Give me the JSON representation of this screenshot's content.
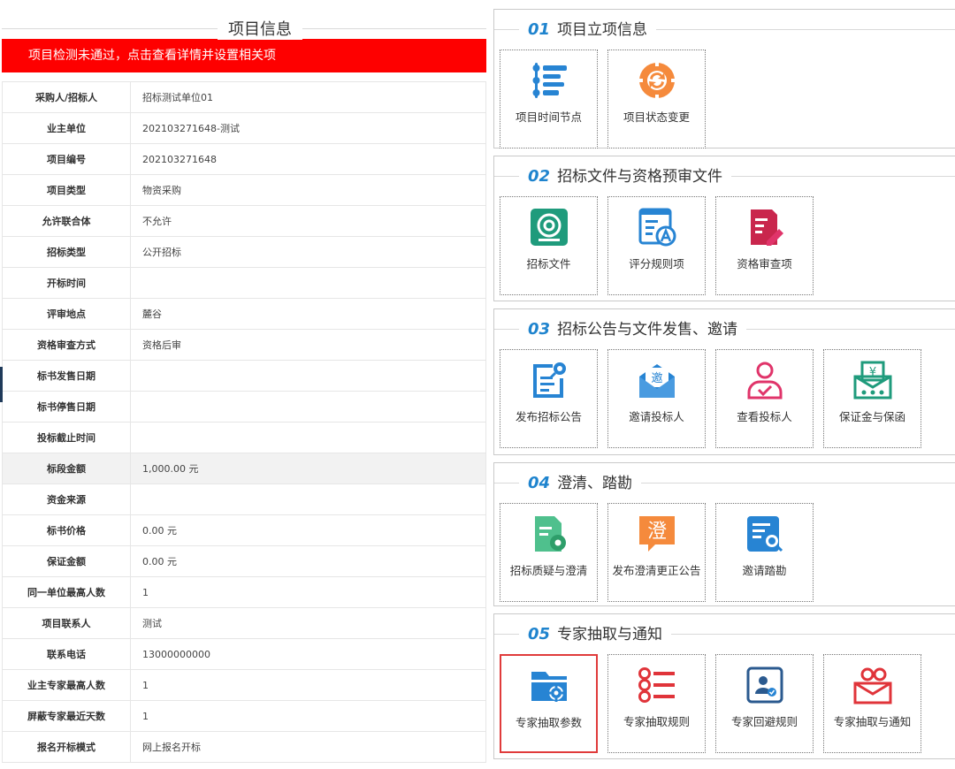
{
  "left": {
    "title": "项目信息",
    "alert": "项目检测未通过，点击查看详情并设置相关项",
    "rows": [
      {
        "label": "采购人/招标人",
        "value": "招标测试单位01"
      },
      {
        "label": "业主单位",
        "value": "202103271648-测试"
      },
      {
        "label": "项目编号",
        "value": "202103271648"
      },
      {
        "label": "项目类型",
        "value": "物资采购"
      },
      {
        "label": "允许联合体",
        "value": "不允许"
      },
      {
        "label": "招标类型",
        "value": "公开招标"
      },
      {
        "label": "开标时间",
        "value": ""
      },
      {
        "label": "评审地点",
        "value": "麓谷"
      },
      {
        "label": "资格审查方式",
        "value": "资格后审"
      },
      {
        "label": "标书发售日期",
        "value": ""
      },
      {
        "label": "标书停售日期",
        "value": ""
      },
      {
        "label": "投标截止时间",
        "value": ""
      },
      {
        "label": "标段金额",
        "value": "1,000.00 元"
      },
      {
        "label": "资金来源",
        "value": ""
      },
      {
        "label": "标书价格",
        "value": "0.00 元"
      },
      {
        "label": "保证金额",
        "value": "0.00 元"
      },
      {
        "label": "同一单位最高人数",
        "value": "1"
      },
      {
        "label": "项目联系人",
        "value": "测试"
      },
      {
        "label": "联系电话",
        "value": "13000000000"
      },
      {
        "label": "业主专家最高人数",
        "value": "1"
      },
      {
        "label": "屏蔽专家最近天数",
        "value": "1"
      },
      {
        "label": "报名开标模式",
        "value": "网上报名开标"
      }
    ]
  },
  "sections": [
    {
      "num": "01",
      "title": "项目立项信息",
      "tiles": [
        {
          "label": "项目时间节点",
          "icon": "timeline-icon"
        },
        {
          "label": "项目状态变更",
          "icon": "status-change-icon"
        }
      ]
    },
    {
      "num": "02",
      "title": "招标文件与资格预审文件",
      "tiles": [
        {
          "label": "招标文件",
          "icon": "tender-file-icon"
        },
        {
          "label": "评分规则项",
          "icon": "scoring-rule-icon"
        },
        {
          "label": "资格审查项",
          "icon": "qualification-review-icon"
        }
      ]
    },
    {
      "num": "03",
      "title": "招标公告与文件发售、邀请",
      "tiles": [
        {
          "label": "发布招标公告",
          "icon": "publish-notice-icon"
        },
        {
          "label": "邀请投标人",
          "icon": "invite-bidder-icon"
        },
        {
          "label": "查看投标人",
          "icon": "view-bidder-icon"
        },
        {
          "label": "保证金与保函",
          "icon": "deposit-guarantee-icon"
        }
      ]
    },
    {
      "num": "04",
      "title": "澄清、踏勘",
      "tiles": [
        {
          "label": "招标质疑与澄清",
          "icon": "query-clarify-icon"
        },
        {
          "label": "发布澄清更正公告",
          "icon": "clarify-notice-icon"
        },
        {
          "label": "邀请踏勘",
          "icon": "invite-survey-icon"
        }
      ]
    },
    {
      "num": "05",
      "title": "专家抽取与通知",
      "tiles": [
        {
          "label": "专家抽取参数",
          "icon": "expert-params-icon"
        },
        {
          "label": "专家抽取规则",
          "icon": "expert-rule-icon"
        },
        {
          "label": "专家回避规则",
          "icon": "expert-avoid-icon"
        },
        {
          "label": "专家抽取与通知",
          "icon": "expert-notify-icon"
        }
      ]
    }
  ],
  "colors": {
    "alert_bg": "#fe0000",
    "section_number": "#1f84ce",
    "selected_border": "#e03b3b",
    "icon_blue": "#2784d3",
    "icon_orange": "#f58a3c",
    "icon_teal": "#1f9b7c",
    "icon_red": "#e0343a",
    "icon_pink": "#e0346a",
    "icon_green": "#4fc08d"
  },
  "selected_tile": "专家抽取参数"
}
